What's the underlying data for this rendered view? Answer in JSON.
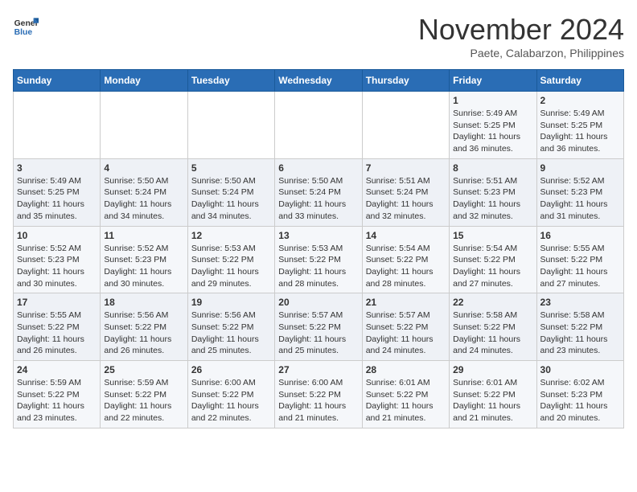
{
  "logo": {
    "general": "General",
    "blue": "Blue"
  },
  "title": "November 2024",
  "subtitle": "Paete, Calabarzon, Philippines",
  "weekdays": [
    "Sunday",
    "Monday",
    "Tuesday",
    "Wednesday",
    "Thursday",
    "Friday",
    "Saturday"
  ],
  "weeks": [
    [
      {
        "day": "",
        "info": ""
      },
      {
        "day": "",
        "info": ""
      },
      {
        "day": "",
        "info": ""
      },
      {
        "day": "",
        "info": ""
      },
      {
        "day": "",
        "info": ""
      },
      {
        "day": "1",
        "info": "Sunrise: 5:49 AM\nSunset: 5:25 PM\nDaylight: 11 hours and 36 minutes."
      },
      {
        "day": "2",
        "info": "Sunrise: 5:49 AM\nSunset: 5:25 PM\nDaylight: 11 hours and 36 minutes."
      }
    ],
    [
      {
        "day": "3",
        "info": "Sunrise: 5:49 AM\nSunset: 5:25 PM\nDaylight: 11 hours and 35 minutes."
      },
      {
        "day": "4",
        "info": "Sunrise: 5:50 AM\nSunset: 5:24 PM\nDaylight: 11 hours and 34 minutes."
      },
      {
        "day": "5",
        "info": "Sunrise: 5:50 AM\nSunset: 5:24 PM\nDaylight: 11 hours and 34 minutes."
      },
      {
        "day": "6",
        "info": "Sunrise: 5:50 AM\nSunset: 5:24 PM\nDaylight: 11 hours and 33 minutes."
      },
      {
        "day": "7",
        "info": "Sunrise: 5:51 AM\nSunset: 5:24 PM\nDaylight: 11 hours and 32 minutes."
      },
      {
        "day": "8",
        "info": "Sunrise: 5:51 AM\nSunset: 5:23 PM\nDaylight: 11 hours and 32 minutes."
      },
      {
        "day": "9",
        "info": "Sunrise: 5:52 AM\nSunset: 5:23 PM\nDaylight: 11 hours and 31 minutes."
      }
    ],
    [
      {
        "day": "10",
        "info": "Sunrise: 5:52 AM\nSunset: 5:23 PM\nDaylight: 11 hours and 30 minutes."
      },
      {
        "day": "11",
        "info": "Sunrise: 5:52 AM\nSunset: 5:23 PM\nDaylight: 11 hours and 30 minutes."
      },
      {
        "day": "12",
        "info": "Sunrise: 5:53 AM\nSunset: 5:22 PM\nDaylight: 11 hours and 29 minutes."
      },
      {
        "day": "13",
        "info": "Sunrise: 5:53 AM\nSunset: 5:22 PM\nDaylight: 11 hours and 28 minutes."
      },
      {
        "day": "14",
        "info": "Sunrise: 5:54 AM\nSunset: 5:22 PM\nDaylight: 11 hours and 28 minutes."
      },
      {
        "day": "15",
        "info": "Sunrise: 5:54 AM\nSunset: 5:22 PM\nDaylight: 11 hours and 27 minutes."
      },
      {
        "day": "16",
        "info": "Sunrise: 5:55 AM\nSunset: 5:22 PM\nDaylight: 11 hours and 27 minutes."
      }
    ],
    [
      {
        "day": "17",
        "info": "Sunrise: 5:55 AM\nSunset: 5:22 PM\nDaylight: 11 hours and 26 minutes."
      },
      {
        "day": "18",
        "info": "Sunrise: 5:56 AM\nSunset: 5:22 PM\nDaylight: 11 hours and 26 minutes."
      },
      {
        "day": "19",
        "info": "Sunrise: 5:56 AM\nSunset: 5:22 PM\nDaylight: 11 hours and 25 minutes."
      },
      {
        "day": "20",
        "info": "Sunrise: 5:57 AM\nSunset: 5:22 PM\nDaylight: 11 hours and 25 minutes."
      },
      {
        "day": "21",
        "info": "Sunrise: 5:57 AM\nSunset: 5:22 PM\nDaylight: 11 hours and 24 minutes."
      },
      {
        "day": "22",
        "info": "Sunrise: 5:58 AM\nSunset: 5:22 PM\nDaylight: 11 hours and 24 minutes."
      },
      {
        "day": "23",
        "info": "Sunrise: 5:58 AM\nSunset: 5:22 PM\nDaylight: 11 hours and 23 minutes."
      }
    ],
    [
      {
        "day": "24",
        "info": "Sunrise: 5:59 AM\nSunset: 5:22 PM\nDaylight: 11 hours and 23 minutes."
      },
      {
        "day": "25",
        "info": "Sunrise: 5:59 AM\nSunset: 5:22 PM\nDaylight: 11 hours and 22 minutes."
      },
      {
        "day": "26",
        "info": "Sunrise: 6:00 AM\nSunset: 5:22 PM\nDaylight: 11 hours and 22 minutes."
      },
      {
        "day": "27",
        "info": "Sunrise: 6:00 AM\nSunset: 5:22 PM\nDaylight: 11 hours and 21 minutes."
      },
      {
        "day": "28",
        "info": "Sunrise: 6:01 AM\nSunset: 5:22 PM\nDaylight: 11 hours and 21 minutes."
      },
      {
        "day": "29",
        "info": "Sunrise: 6:01 AM\nSunset: 5:22 PM\nDaylight: 11 hours and 21 minutes."
      },
      {
        "day": "30",
        "info": "Sunrise: 6:02 AM\nSunset: 5:23 PM\nDaylight: 11 hours and 20 minutes."
      }
    ]
  ]
}
